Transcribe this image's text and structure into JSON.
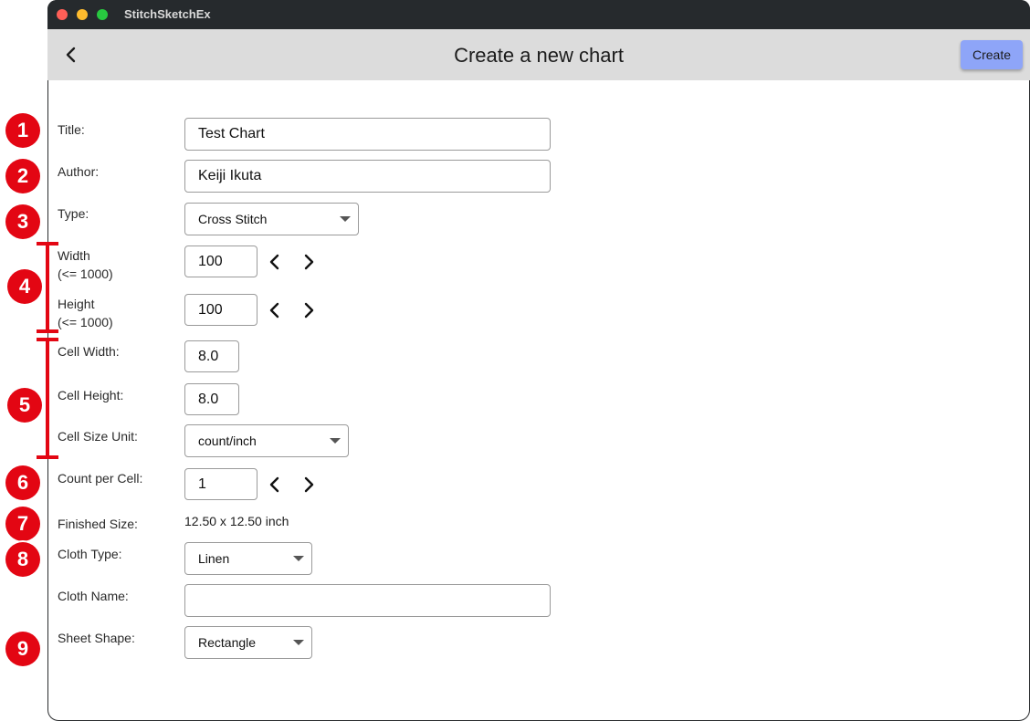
{
  "window": {
    "app_name": "StitchSketchEx"
  },
  "appbar": {
    "title": "Create a new chart",
    "create_label": "Create"
  },
  "form": {
    "title": {
      "label": "Title:",
      "value": "Test Chart"
    },
    "author": {
      "label": "Author:",
      "value": "Keiji Ikuta"
    },
    "type": {
      "label": "Type:",
      "value": "Cross Stitch"
    },
    "width": {
      "label_line1": "Width",
      "label_line2": "(<= 1000)",
      "value": "100"
    },
    "height": {
      "label_line1": "Height",
      "label_line2": "(<= 1000)",
      "value": "100"
    },
    "cell_width": {
      "label": "Cell Width:",
      "value": "8.0"
    },
    "cell_height": {
      "label": "Cell Height:",
      "value": "8.0"
    },
    "cell_size_unit": {
      "label": "Cell Size Unit:",
      "value": "count/inch"
    },
    "count_per_cell": {
      "label": "Count per Cell:",
      "value": "1"
    },
    "finished_size": {
      "label": "Finished Size:",
      "value": "12.50 x 12.50 inch"
    },
    "cloth_type": {
      "label": "Cloth Type:",
      "value": "Linen"
    },
    "cloth_name": {
      "label": "Cloth Name:",
      "value": ""
    },
    "sheet_shape": {
      "label": "Sheet Shape:",
      "value": "Rectangle"
    }
  },
  "annotations": [
    "1",
    "2",
    "3",
    "4",
    "5",
    "6",
    "7",
    "8",
    "9"
  ],
  "colors": {
    "annotation_red": "#e30613",
    "create_button": "#8ea5f8",
    "appbar": "#dcdcdc",
    "titlebar": "#262a2d"
  },
  "icons": {
    "back": "chevron-left-icon",
    "decrement": "chevron-left-icon",
    "increment": "chevron-right-icon",
    "dropdown": "caret-down-icon"
  }
}
